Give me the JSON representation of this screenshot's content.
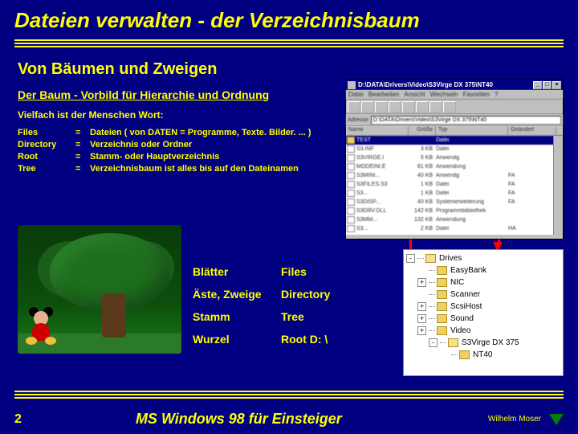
{
  "title": "Dateien verwalten - der Verzeichnisbaum",
  "subtitle": "Von Bäumen und Zweigen",
  "subheading": "Der Baum - Vorbild für Hierarchie und Ordnung",
  "intro": "Vielfach ist der Menschen Wort:",
  "definitions": [
    {
      "term": "Files",
      "eq": "=",
      "desc": "Dateien  ( von DATEN = Programme, Texte. Bilder. ... )"
    },
    {
      "term": "Directory",
      "eq": "=",
      "desc": "Verzeichnis oder Ordner"
    },
    {
      "term": "Root",
      "eq": "=",
      "desc": "Stamm- oder Hauptverzeichnis"
    },
    {
      "term": "Tree",
      "eq": "=",
      "desc": "Verzeichnisbaum ist alles bis auf den Dateinamen"
    }
  ],
  "analogy": [
    {
      "left": "Blätter",
      "right": "Files"
    },
    {
      "left": "Äste, Zweige",
      "right": "Directory"
    },
    {
      "left": "Stamm",
      "right": "Tree"
    },
    {
      "left": "Wurzel",
      "right": "Root D: \\"
    }
  ],
  "window": {
    "title": "D:\\DATA\\Drivers\\Video\\S3Virge DX 375\\NT40",
    "menu": [
      "Datei",
      "Bearbeiten",
      "Ansicht",
      "Wechseln",
      "Favoriten",
      "?"
    ],
    "addressLabel": "Adresse",
    "address": "D:\\DATA\\Drivers\\Video\\S3Virge DX 375\\NT40",
    "columns": {
      "name": "Name",
      "size": "Größe",
      "type": "Typ",
      "mod": "Geändert"
    },
    "rows": [
      {
        "sel": true,
        "folder": true,
        "name": "TEST",
        "size": "",
        "type": "Datei",
        "mod": ""
      },
      {
        "sel": false,
        "folder": false,
        "name": "S3.INF",
        "size": "3 KB",
        "type": "Datei",
        "mod": ""
      },
      {
        "sel": false,
        "folder": false,
        "name": "S3VIRGE.I",
        "size": "5 KB",
        "type": "Anwendg",
        "mod": ""
      },
      {
        "sel": false,
        "folder": false,
        "name": "MODEINI.E",
        "size": "81 KB",
        "type": "Anwendung",
        "mod": ""
      },
      {
        "sel": false,
        "folder": false,
        "name": "S3MINI...",
        "size": "40 KB",
        "type": "Anwendg",
        "mod": "FA"
      },
      {
        "sel": false,
        "folder": false,
        "name": "S3FILES.S3",
        "size": "1 KB",
        "type": "Datei",
        "mod": "FA"
      },
      {
        "sel": false,
        "folder": false,
        "name": "S3...",
        "size": "1 KB",
        "type": "Datei",
        "mod": "FA"
      },
      {
        "sel": false,
        "folder": false,
        "name": "S3DISP...",
        "size": "40 KB",
        "type": "Systemerweiterung",
        "mod": "FA"
      },
      {
        "sel": false,
        "folder": false,
        "name": "S3DRV.DLL",
        "size": "142 KB",
        "type": "Programmbibliothek",
        "mod": ""
      },
      {
        "sel": false,
        "folder": false,
        "name": "S3MM...",
        "size": "132 KB",
        "type": "Anwendung",
        "mod": ""
      },
      {
        "sel": false,
        "folder": false,
        "name": "S3...",
        "size": "2 KB",
        "type": "Datei",
        "mod": "HA"
      }
    ]
  },
  "tree": [
    {
      "exp": "-",
      "indent": 0,
      "open": true,
      "label": "Drives"
    },
    {
      "exp": "",
      "indent": 1,
      "open": false,
      "label": "EasyBank"
    },
    {
      "exp": "+",
      "indent": 1,
      "open": false,
      "label": "NIC"
    },
    {
      "exp": "",
      "indent": 1,
      "open": false,
      "label": "Scanner"
    },
    {
      "exp": "+",
      "indent": 1,
      "open": false,
      "label": "ScsiHost"
    },
    {
      "exp": "+",
      "indent": 1,
      "open": false,
      "label": "Sound"
    },
    {
      "exp": "+",
      "indent": 1,
      "open": false,
      "label": "Video"
    },
    {
      "exp": "-",
      "indent": 2,
      "open": true,
      "label": "S3Virge DX 375"
    },
    {
      "exp": "",
      "indent": 3,
      "open": false,
      "label": "NT40"
    }
  ],
  "footer": {
    "page": "2",
    "title": "MS Windows 98 für Einsteiger",
    "author": "Wilhelm Moser"
  }
}
